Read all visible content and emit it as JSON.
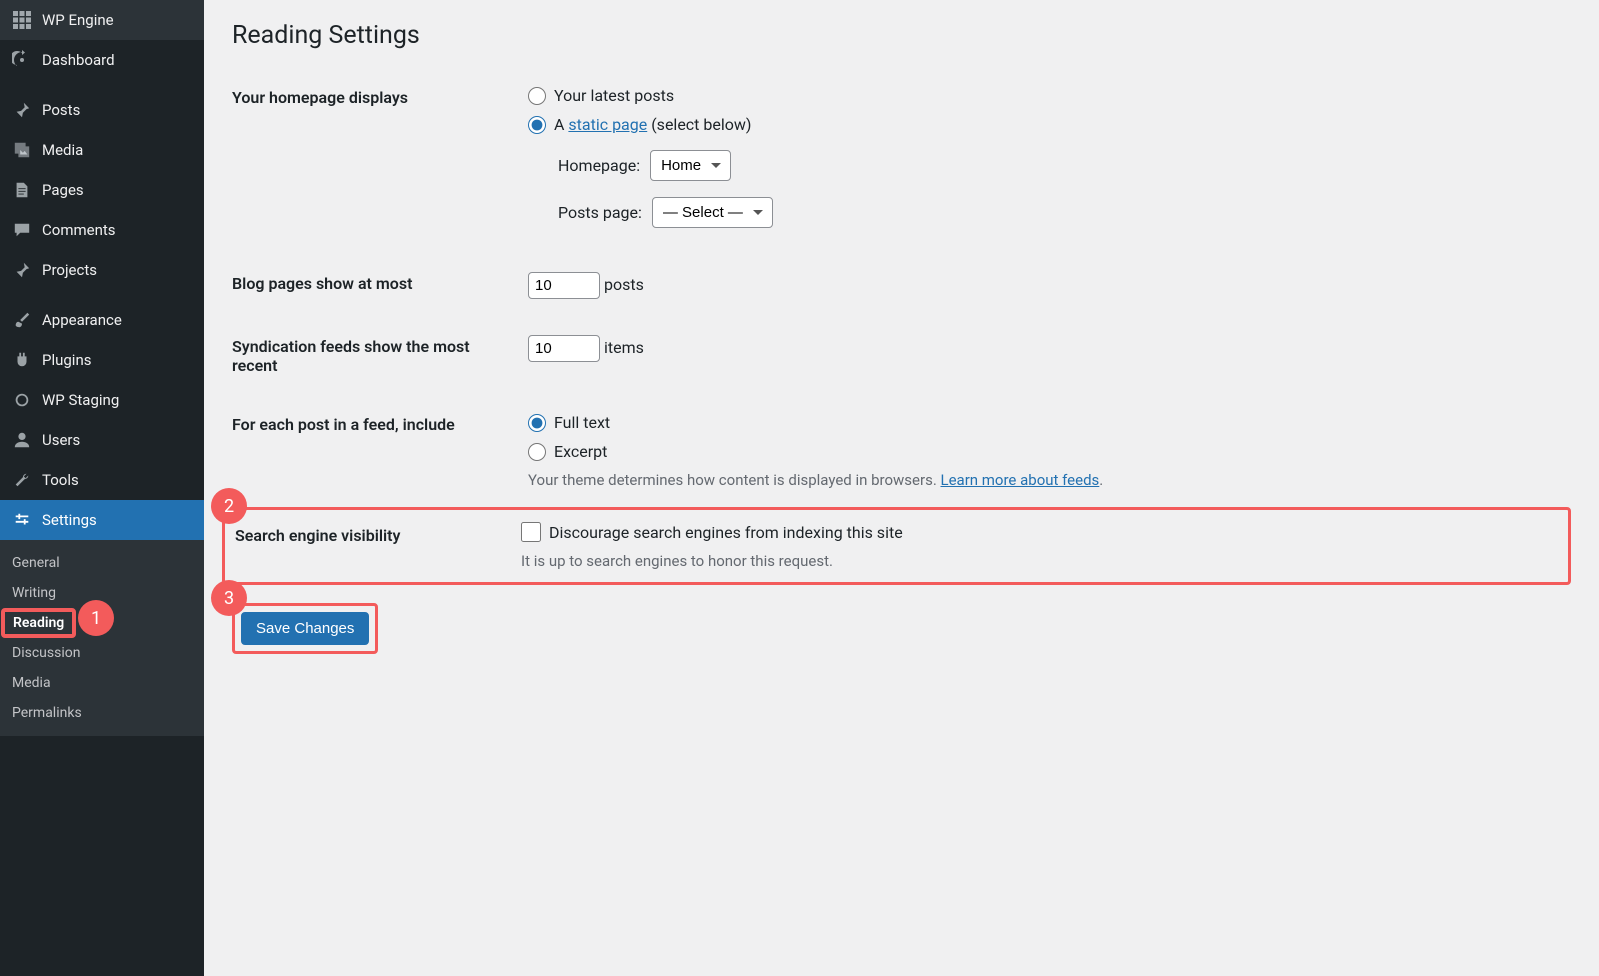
{
  "sidebar": {
    "items": [
      "WP Engine",
      "Dashboard",
      "Posts",
      "Media",
      "Pages",
      "Comments",
      "Projects",
      "Appearance",
      "Plugins",
      "WP Staging",
      "Users",
      "Tools",
      "Settings"
    ]
  },
  "submenu": {
    "items": [
      "General",
      "Writing",
      "Reading",
      "Discussion",
      "Media",
      "Permalinks"
    ]
  },
  "callouts": {
    "one": "1",
    "two": "2",
    "three": "3"
  },
  "page": {
    "title": "Reading Settings"
  },
  "homepage": {
    "label": "Your homepage displays",
    "opt_latest": "Your latest posts",
    "opt_static_prefix": "A ",
    "opt_static_link": "static page",
    "opt_static_suffix": " (select below)",
    "homepage_label": "Homepage:",
    "homepage_value": "Home",
    "postspage_label": "Posts page:",
    "postspage_value": "— Select —"
  },
  "blog_pages": {
    "label": "Blog pages show at most",
    "value": "10",
    "unit": "posts"
  },
  "syndication": {
    "label": "Syndication feeds show the most recent",
    "value": "10",
    "unit": "items"
  },
  "feed_content": {
    "label": "For each post in a feed, include",
    "opt_full": "Full text",
    "opt_excerpt": "Excerpt",
    "desc": "Your theme determines how content is displayed in browsers. ",
    "link": "Learn more about feeds"
  },
  "visibility": {
    "label": "Search engine visibility",
    "checkbox_label": "Discourage search engines from indexing this site",
    "desc": "It is up to search engines to honor this request."
  },
  "submit": {
    "label": "Save Changes"
  }
}
